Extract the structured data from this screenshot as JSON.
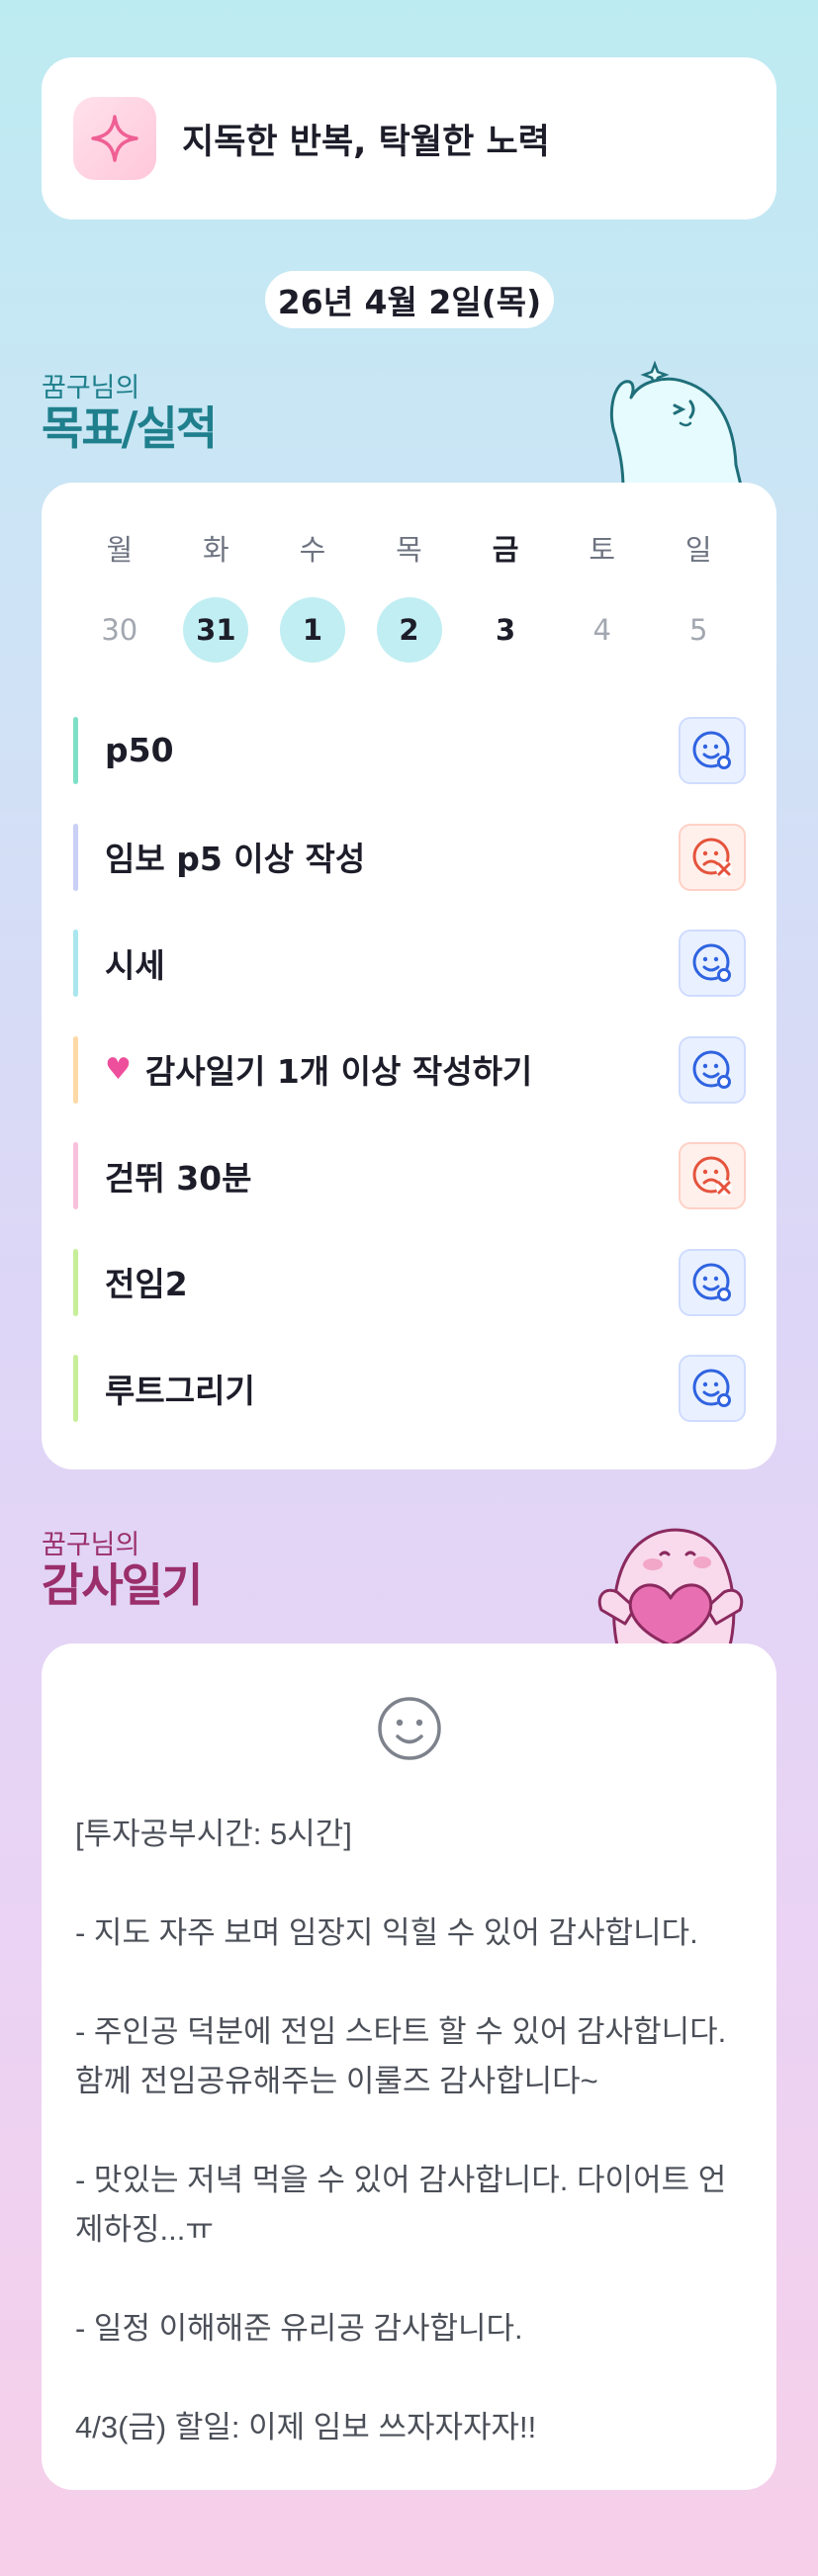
{
  "motto": {
    "icon": "sparkle-icon",
    "text": "지독한 반복, 탁월한 노력"
  },
  "date_label": "26년 4월 2일(목)",
  "goal_section": {
    "subtitle": "꿈구님의",
    "title": "목표/실적"
  },
  "week": [
    {
      "name": "월",
      "num": "30",
      "state": "none"
    },
    {
      "name": "화",
      "num": "31",
      "state": "done"
    },
    {
      "name": "수",
      "num": "1",
      "state": "done"
    },
    {
      "name": "목",
      "num": "2",
      "state": "done"
    },
    {
      "name": "금",
      "num": "3",
      "state": "today"
    },
    {
      "name": "토",
      "num": "4",
      "state": "none"
    },
    {
      "name": "일",
      "num": "5",
      "state": "none"
    }
  ],
  "goals": [
    {
      "label": "p50",
      "status": "done",
      "color": "#7ee0c6"
    },
    {
      "label": "임보 p5 이상 작성",
      "status": "fail",
      "color": "#c9cff5"
    },
    {
      "label": "시세",
      "status": "done",
      "color": "#a9e6ef"
    },
    {
      "label": "감사일기 1개 이상 작성하기",
      "status": "done",
      "color": "#ffd9a6",
      "icon": "heart-icon"
    },
    {
      "label": "걷뛰 30분",
      "status": "fail",
      "color": "#f7c1dc"
    },
    {
      "label": "전임2",
      "status": "done",
      "color": "#c7ef9a"
    },
    {
      "label": "루트그리기",
      "status": "done",
      "color": "#c7ef9a"
    }
  ],
  "gratitude_section": {
    "subtitle": "꿈구님의",
    "title": "감사일기"
  },
  "gratitude": {
    "mood_icon": "smile-icon",
    "paragraphs": [
      "[투자공부시간: 5시간]",
      "- 지도 자주 보며 임장지 익힐 수 있어 감사합니다.",
      "- 주인공 덕분에 전임 스타트 할 수 있어 감사합니다. 함께 전임공유해주는 이룰즈 감사합니다~",
      "- 맛있는 저녁 먹을 수 있어 감사합니다. 다이어트 언제하징...ㅠ",
      "- 일정 이해해준 유리공 감사합니다.",
      "4/3(금) 할일: 이제 임보 쓰자자자자!!"
    ]
  },
  "colors": {
    "done": "#2f63e0",
    "fail": "#e5533c",
    "accent_teal": "#1f7f8c",
    "accent_plum": "#9a2f6b"
  }
}
